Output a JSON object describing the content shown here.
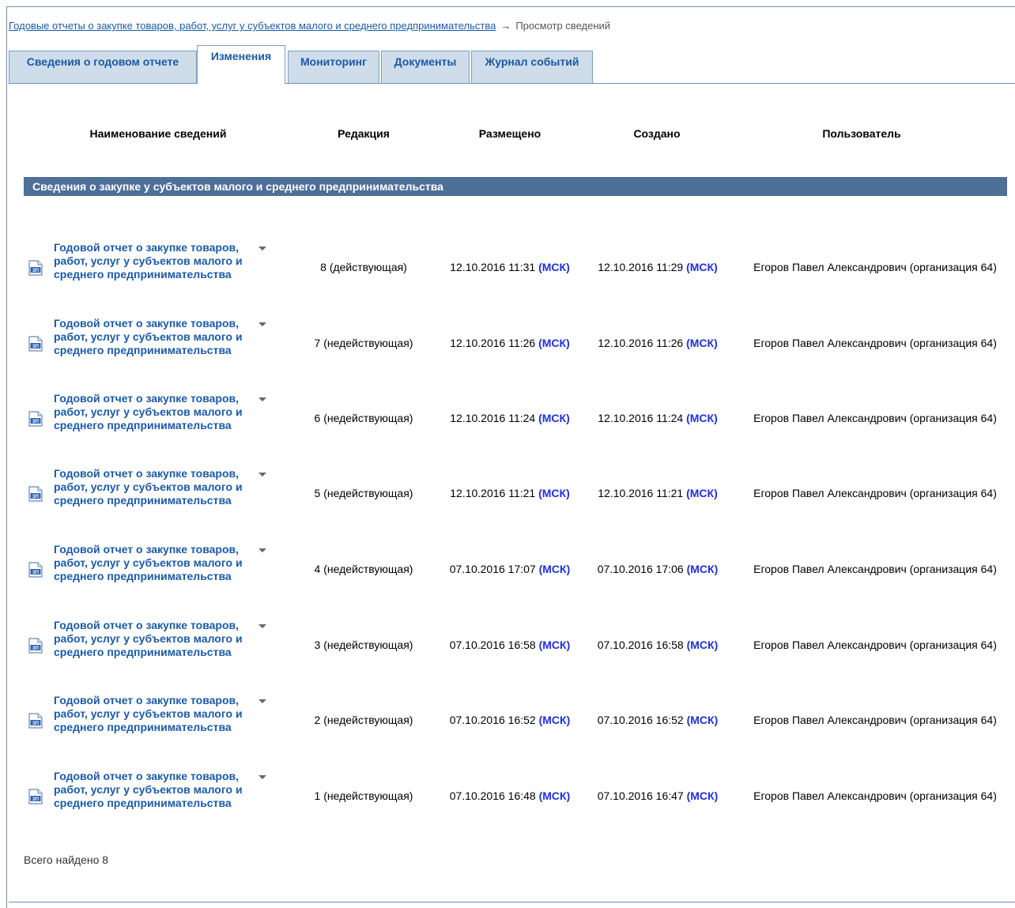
{
  "breadcrumb": {
    "link": "Годовые отчеты о закупке товаров, работ, услуг у субъектов малого и среднего предпринимательства",
    "arrow": "→",
    "current": "Просмотр сведений"
  },
  "tabs": [
    {
      "label": "Сведения о годовом отчете"
    },
    {
      "label": "Изменения"
    },
    {
      "label": "Мониторинг"
    },
    {
      "label": "Документы"
    },
    {
      "label": "Журнал событий"
    }
  ],
  "columns": {
    "name": "Наименование сведений",
    "edition": "Редакция",
    "placed": "Размещено",
    "created": "Создано",
    "user": "Пользователь"
  },
  "section_title": "Сведения о закупке у субъектов малого и среднего предпринимательства",
  "tz_label": "(МСК)",
  "rows": [
    {
      "title": "Годовой отчет о закупке товаров, работ, услуг у субъектов малого и среднего предпринимательства",
      "edition": "8 (действующая)",
      "placed": "12.10.2016 11:31",
      "created": "12.10.2016 11:29",
      "user": "Егоров Павел Александрович (организация 64)"
    },
    {
      "title": "Годовой отчет о закупке товаров, работ, услуг у субъектов малого и среднего предпринимательства",
      "edition": "7 (недействующая)",
      "placed": "12.10.2016 11:26",
      "created": "12.10.2016 11:26",
      "user": "Егоров Павел Александрович (организация 64)"
    },
    {
      "title": "Годовой отчет о закупке товаров, работ, услуг у субъектов малого и среднего предпринимательства",
      "edition": "6 (недействующая)",
      "placed": "12.10.2016 11:24",
      "created": "12.10.2016 11:24",
      "user": "Егоров Павел Александрович (организация 64)"
    },
    {
      "title": "Годовой отчет о закупке товаров, работ, услуг у субъектов малого и среднего предпринимательства",
      "edition": "5 (недействующая)",
      "placed": "12.10.2016 11:21",
      "created": "12.10.2016 11:21",
      "user": "Егоров Павел Александрович (организация 64)"
    },
    {
      "title": "Годовой отчет о закупке товаров, работ, услуг у субъектов малого и среднего предпринимательства",
      "edition": "4 (недействующая)",
      "placed": "07.10.2016 17:07",
      "created": "07.10.2016 17:06",
      "user": "Егоров Павел Александрович (организация 64)"
    },
    {
      "title": "Годовой отчет о закупке товаров, работ, услуг у субъектов малого и среднего предпринимательства",
      "edition": "3 (недействующая)",
      "placed": "07.10.2016 16:58",
      "created": "07.10.2016 16:58",
      "user": "Егоров Павел Александрович (организация 64)"
    },
    {
      "title": "Годовой отчет о закупке товаров, работ, услуг у субъектов малого и среднего предпринимательства",
      "edition": "2 (недействующая)",
      "placed": "07.10.2016 16:52",
      "created": "07.10.2016 16:52",
      "user": "Егоров Павел Александрович (организация 64)"
    },
    {
      "title": "Годовой отчет о закупке товаров, работ, услуг у субъектов малого и среднего предпринимательства",
      "edition": "1 (недействующая)",
      "placed": "07.10.2016 16:48",
      "created": "07.10.2016 16:47",
      "user": "Егоров Павел Александрович (организация 64)"
    }
  ],
  "doc_icon": {
    "name": "document-icon",
    "text": "ЗП"
  },
  "total": "Всего найдено 8",
  "colors": {
    "accent": "#1b5aa8",
    "section_bar": "#4e6f98",
    "tab_bg": "#cfdcea",
    "tz": "#1f2fe0"
  }
}
